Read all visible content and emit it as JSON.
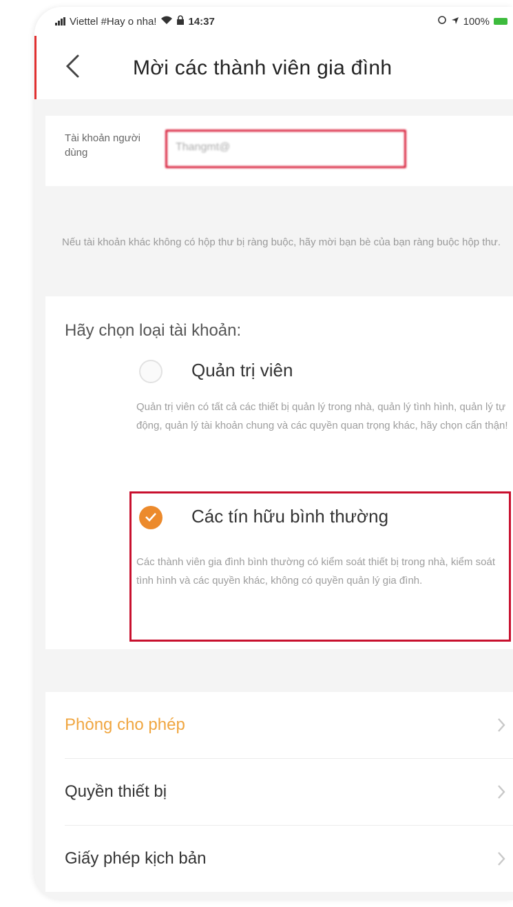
{
  "status_bar": {
    "carrier": "Viettel #Hay o nha!",
    "time": "14:37",
    "battery": "100%"
  },
  "header": {
    "title": "Mời các thành viên gia đình",
    "back_icon": "chevron-left-icon"
  },
  "account": {
    "label": "Tài khoản người dùng",
    "value": "Thangmt@"
  },
  "hint": "Nếu tài khoản khác không có hộp thư bị ràng buộc, hãy mời bạn bè của bạn ràng buộc hộp thư.",
  "account_type": {
    "title": "Hãy chọn loại tài khoản:",
    "options": [
      {
        "label": "Quản trị viên",
        "description": "Quản trị viên có tất cả các thiết bị quản lý trong nhà, quản lý tình hình, quản lý tự động, quản lý tài khoản chung và các quyền quan trọng khác, hãy chọn cẩn thận!",
        "selected": false
      },
      {
        "label": "Các tín hữu bình thường",
        "description": "Các thành viên gia đình bình thường có kiểm soát thiết bị trong nhà, kiểm soát tình hình và các quyền khác, không có quyền quản lý gia đình.",
        "selected": true
      }
    ]
  },
  "menu": [
    {
      "label": "Phòng cho phép",
      "accent": true
    },
    {
      "label": "Quyền thiết bị",
      "accent": false
    },
    {
      "label": "Giấy phép kịch bản",
      "accent": false
    }
  ],
  "colors": {
    "accent": "#ec8a2c",
    "highlight": "#c8102e",
    "menu_accent": "#f0a640"
  }
}
